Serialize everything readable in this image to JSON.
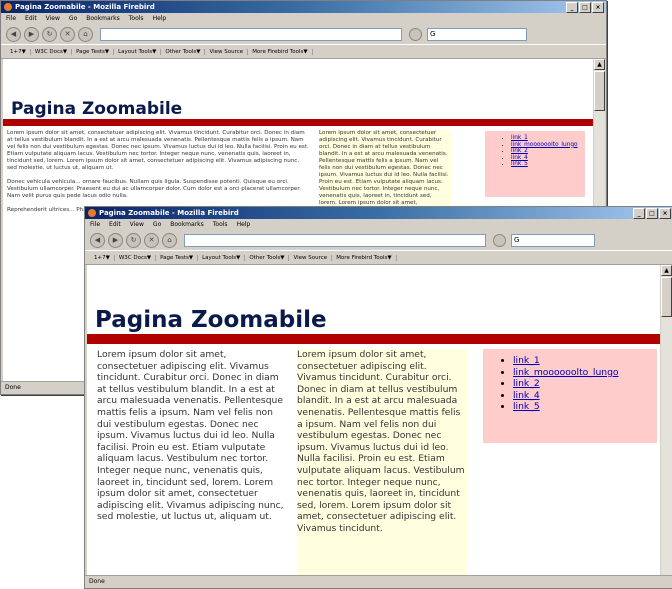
{
  "browser": {
    "window_title": "Pagina Zoomabile - Mozilla Firebird",
    "menu": [
      "File",
      "Edit",
      "View",
      "Go",
      "Bookmarks",
      "Tools",
      "Help"
    ],
    "search_value": "G",
    "toolbar": [
      "1+7▼",
      "W3C Docs▼",
      "Page Tests▼",
      "Layout Tools▼",
      "Other Tools▼",
      "View Source",
      "More Firebird Tools▼"
    ],
    "status": "Done"
  },
  "page": {
    "heading": "Pagina Zoomabile",
    "col1_text": "Lorem ipsum dolor sit amet, consectetuer adipiscing elit. Vivamus tincidunt. Curabitur orci. Donec in diam at tellus vestibulum blandit. In a est at arcu malesuada venenatis. Pellentesque mattis felis a ipsum. Nam vel felis non dui vestibulum egestas. Donec nec ipsum. Vivamus luctus dui id leo. Nulla facilisi. Proin eu est. Etiam vulputate aliquam lacus. Vestibulum nec tortor. Integer neque nunc, venenatis quis, laoreet in, tincidunt sed, lorem. Lorem ipsum dolor sit amet, consectetuer adipiscing elit. Vivamus adipiscing nunc, sed molestie, ut luctus ut, aliquam ut.",
    "col1_text_b": "Donec vehicula vehicula... ornare faucibus. Nullam quis ligula. Suspendisse potenti. Quisque eu orci. Vestibulum ullamcorper. Praesent eu dui ac ullamcorper dolor. Cum dolor est a orci placerat ullamcorper. Nam velit purus quis pede lacus odio nulla.",
    "col1_text_c": "Reprehenderit ultrices... Phasellus eu orci.",
    "col2_text": "Lorem ipsum dolor sit amet, consectetuer adipiscing elit. Vivamus tincidunt. Curabitur orci. Donec in diam at tellus vestibulum blandit. In a est at arcu malesuada venenatis. Pellentesque mattis felis a ipsum. Nam vel felis non dui vestibulum egestas. Donec nec ipsum. Vivamus luctus dui id leo. Nulla facilisi. Proin eu est. Etiam vulputate aliquam lacus. Vestibulum nec tortor. Integer neque nunc, venenatis quis, laoreet in, tincidunt sed, lorem. Lorem ipsum dolor sit amet, consectetuer adipiscing elit. Vivamus tincidunt.",
    "links": [
      "link_1",
      "link_moooooolto_lungo",
      "link_2",
      "link_4",
      "link_5"
    ]
  },
  "colors": {
    "title_gradient_start": "#0a246a",
    "accent_bar": "#b00000",
    "links_box_bg": "#ffcccc",
    "col2_bg": "#ffffe0",
    "heading_color": "#0b1a4a"
  }
}
